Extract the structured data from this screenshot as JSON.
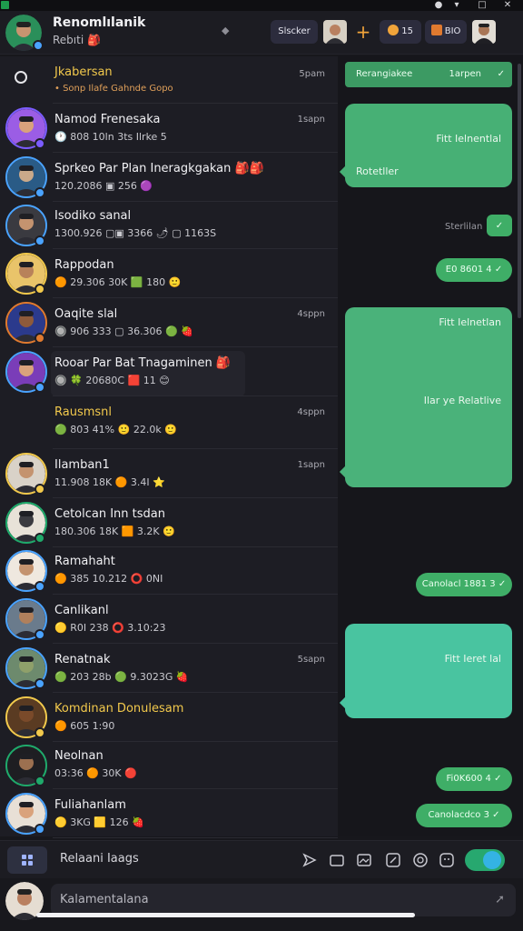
{
  "header": {
    "title": "Renomlılanik",
    "subtitle": "Rebıti 🎒",
    "pin_icon": "pin-icon",
    "button1_label": "Slscker",
    "plus_icon": "plus-icon",
    "chip1_label": "15",
    "chip2_label": "BIO"
  },
  "chats": [
    {
      "name": "Jkabersan",
      "sub": "• Sonp Ilafe Gahnde Gopo",
      "time": "5pam",
      "name_color": "#f2c94c",
      "kind": "special"
    },
    {
      "name": "Namod Frenesaka",
      "sub": "🕐 808 10ln 3ts Ilrke 5",
      "time": "1sapn",
      "ring": "#7b5cff",
      "skin": "#d9a27c",
      "bg": "#9b5de5"
    },
    {
      "name": "Sprkeo Par Plan Ineragkgakan 🎒🎒",
      "sub": "120.2086 ▣ 256 🟣",
      "time": "",
      "ring": "#4aa3ff",
      "skin": "#caa98a",
      "bg": "#2a5b86"
    },
    {
      "name": "Isodiko sanal",
      "sub": "1300.926 ▢▣ 3366 🌶 ▢ 1163S",
      "time": "",
      "ring": "#4aa3ff",
      "skin": "#c4936f",
      "bg": "#3a3a40"
    },
    {
      "name": "Rappodan",
      "sub": "🟠 29.306 30K 🟩 180 🙂",
      "time": "",
      "ring": "#f2c94c",
      "skin": "#b8825a",
      "bg": "#e9c46a"
    },
    {
      "name": "Oaqite slal",
      "sub": "🔘 906 333 ▢ 36.306 🟢 🍓",
      "time": "4sppn",
      "ring": "#e07a2f",
      "skin": "#8d5a3b",
      "bg": "#2b3a8c"
    },
    {
      "name": "Rooar Par Bat Tnagaminen 🎒",
      "sub": "🔘 🍀 20680C 🟥 11 😊",
      "time": "",
      "ring": "#4aa3ff",
      "skin": "#d9a27c",
      "bg": "#7a3db8"
    },
    {
      "name": "Rausmsnl",
      "sub": "🟢 803 41% 🙂 22.0k 🙂",
      "time": "4sppn",
      "name_color": "#f2c94c",
      "kind": "noavatar"
    },
    {
      "name": "Ilamban1",
      "sub": "11.908 18K 🟠 3.4I ⭐",
      "time": "1sapn",
      "ring": "#f2c94c",
      "skin": "#c4936f",
      "bg": "#d9d2c8"
    },
    {
      "name": "Cetolcan Inn tsdan",
      "sub": "180.306 18K 🟧 3.2K 🙂",
      "time": "",
      "ring": "#1faa6b",
      "skin": "#3b3b40",
      "bg": "#e8e2d8"
    },
    {
      "name": "Ramahaht",
      "sub": "🟠 385 10.212 ⭕ 0NI",
      "time": "",
      "ring": "#4aa3ff",
      "skin": "#c4936f",
      "bg": "#efe8df"
    },
    {
      "name": "Canlikanl",
      "sub": "🟡 R0I 238 ⭕ 3.10:23",
      "time": "",
      "ring": "#4aa3ff",
      "skin": "#b0805c",
      "bg": "#6a7b8c"
    },
    {
      "name": "Renatnak",
      "sub": "🟢 203 28b 🟢 9.3023G 🍓",
      "time": "5sapn",
      "ring": "#4aa3ff",
      "skin": "#8fa06a",
      "bg": "#6d8a6d"
    },
    {
      "name": "Komdinan Donulesam",
      "sub": "🟠 605 1:90",
      "time": "",
      "name_color": "#f2c94c",
      "ring": "#f2c94c",
      "skin": "#7a4a2a",
      "bg": "#5a3b22"
    },
    {
      "name": "Neolnan",
      "sub": "03:36 🟠 30K 🔴",
      "time": "",
      "ring": "#1faa6b",
      "skin": "#9c7050",
      "bg": "#1e1e22"
    },
    {
      "name": "Fuliahanlam",
      "sub": "🟡 3KG 🟨 126 🍓",
      "time": "",
      "ring": "#4aa3ff",
      "skin": "#d9a27c",
      "bg": "#e8e0d6"
    }
  ],
  "conversation": {
    "top_pill_label": "Rerangiakee",
    "top_pill_time": "1arpen",
    "bubble1_text": "Fitt Ielnentlal",
    "bubble1_sub": "Rotetller",
    "status_text": "Sterlilan",
    "pill2_label": "E0 8601 4",
    "bubble2_text": "Fitt Ielnetlan",
    "bubble2_sub": "Ilar ye Relatlive",
    "pill3_label": "Canolacl 1881 3",
    "bubble3_text": "Fitt Ieret lal",
    "pill4_label": "Fi0K600 4",
    "pill5_label": "Canolacdco 3"
  },
  "toolbar": {
    "label": "Relaani Iaags",
    "icons": [
      "send-icon",
      "folder-icon",
      "image-icon",
      "edit-icon",
      "at-icon",
      "sticker-icon"
    ]
  },
  "composer": {
    "placeholder": "Kalamentalana",
    "progress": 0.85
  },
  "colors": {
    "accent_green": "#3fae67",
    "bubble_teal": "#49c4a0",
    "highlight_yellow": "#f2c94c"
  }
}
